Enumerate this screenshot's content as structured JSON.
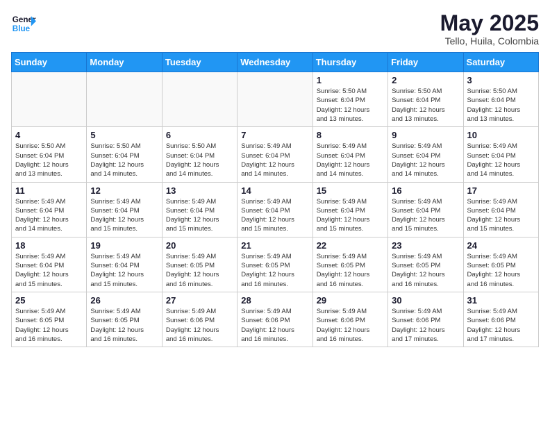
{
  "header": {
    "logo_line1": "General",
    "logo_line2": "Blue",
    "month": "May 2025",
    "location": "Tello, Huila, Colombia"
  },
  "days_of_week": [
    "Sunday",
    "Monday",
    "Tuesday",
    "Wednesday",
    "Thursday",
    "Friday",
    "Saturday"
  ],
  "weeks": [
    [
      {
        "day": "",
        "info": ""
      },
      {
        "day": "",
        "info": ""
      },
      {
        "day": "",
        "info": ""
      },
      {
        "day": "",
        "info": ""
      },
      {
        "day": "1",
        "info": "Sunrise: 5:50 AM\nSunset: 6:04 PM\nDaylight: 12 hours\nand 13 minutes."
      },
      {
        "day": "2",
        "info": "Sunrise: 5:50 AM\nSunset: 6:04 PM\nDaylight: 12 hours\nand 13 minutes."
      },
      {
        "day": "3",
        "info": "Sunrise: 5:50 AM\nSunset: 6:04 PM\nDaylight: 12 hours\nand 13 minutes."
      }
    ],
    [
      {
        "day": "4",
        "info": "Sunrise: 5:50 AM\nSunset: 6:04 PM\nDaylight: 12 hours\nand 13 minutes."
      },
      {
        "day": "5",
        "info": "Sunrise: 5:50 AM\nSunset: 6:04 PM\nDaylight: 12 hours\nand 14 minutes."
      },
      {
        "day": "6",
        "info": "Sunrise: 5:50 AM\nSunset: 6:04 PM\nDaylight: 12 hours\nand 14 minutes."
      },
      {
        "day": "7",
        "info": "Sunrise: 5:49 AM\nSunset: 6:04 PM\nDaylight: 12 hours\nand 14 minutes."
      },
      {
        "day": "8",
        "info": "Sunrise: 5:49 AM\nSunset: 6:04 PM\nDaylight: 12 hours\nand 14 minutes."
      },
      {
        "day": "9",
        "info": "Sunrise: 5:49 AM\nSunset: 6:04 PM\nDaylight: 12 hours\nand 14 minutes."
      },
      {
        "day": "10",
        "info": "Sunrise: 5:49 AM\nSunset: 6:04 PM\nDaylight: 12 hours\nand 14 minutes."
      }
    ],
    [
      {
        "day": "11",
        "info": "Sunrise: 5:49 AM\nSunset: 6:04 PM\nDaylight: 12 hours\nand 14 minutes."
      },
      {
        "day": "12",
        "info": "Sunrise: 5:49 AM\nSunset: 6:04 PM\nDaylight: 12 hours\nand 15 minutes."
      },
      {
        "day": "13",
        "info": "Sunrise: 5:49 AM\nSunset: 6:04 PM\nDaylight: 12 hours\nand 15 minutes."
      },
      {
        "day": "14",
        "info": "Sunrise: 5:49 AM\nSunset: 6:04 PM\nDaylight: 12 hours\nand 15 minutes."
      },
      {
        "day": "15",
        "info": "Sunrise: 5:49 AM\nSunset: 6:04 PM\nDaylight: 12 hours\nand 15 minutes."
      },
      {
        "day": "16",
        "info": "Sunrise: 5:49 AM\nSunset: 6:04 PM\nDaylight: 12 hours\nand 15 minutes."
      },
      {
        "day": "17",
        "info": "Sunrise: 5:49 AM\nSunset: 6:04 PM\nDaylight: 12 hours\nand 15 minutes."
      }
    ],
    [
      {
        "day": "18",
        "info": "Sunrise: 5:49 AM\nSunset: 6:04 PM\nDaylight: 12 hours\nand 15 minutes."
      },
      {
        "day": "19",
        "info": "Sunrise: 5:49 AM\nSunset: 6:04 PM\nDaylight: 12 hours\nand 15 minutes."
      },
      {
        "day": "20",
        "info": "Sunrise: 5:49 AM\nSunset: 6:05 PM\nDaylight: 12 hours\nand 16 minutes."
      },
      {
        "day": "21",
        "info": "Sunrise: 5:49 AM\nSunset: 6:05 PM\nDaylight: 12 hours\nand 16 minutes."
      },
      {
        "day": "22",
        "info": "Sunrise: 5:49 AM\nSunset: 6:05 PM\nDaylight: 12 hours\nand 16 minutes."
      },
      {
        "day": "23",
        "info": "Sunrise: 5:49 AM\nSunset: 6:05 PM\nDaylight: 12 hours\nand 16 minutes."
      },
      {
        "day": "24",
        "info": "Sunrise: 5:49 AM\nSunset: 6:05 PM\nDaylight: 12 hours\nand 16 minutes."
      }
    ],
    [
      {
        "day": "25",
        "info": "Sunrise: 5:49 AM\nSunset: 6:05 PM\nDaylight: 12 hours\nand 16 minutes."
      },
      {
        "day": "26",
        "info": "Sunrise: 5:49 AM\nSunset: 6:05 PM\nDaylight: 12 hours\nand 16 minutes."
      },
      {
        "day": "27",
        "info": "Sunrise: 5:49 AM\nSunset: 6:06 PM\nDaylight: 12 hours\nand 16 minutes."
      },
      {
        "day": "28",
        "info": "Sunrise: 5:49 AM\nSunset: 6:06 PM\nDaylight: 12 hours\nand 16 minutes."
      },
      {
        "day": "29",
        "info": "Sunrise: 5:49 AM\nSunset: 6:06 PM\nDaylight: 12 hours\nand 16 minutes."
      },
      {
        "day": "30",
        "info": "Sunrise: 5:49 AM\nSunset: 6:06 PM\nDaylight: 12 hours\nand 17 minutes."
      },
      {
        "day": "31",
        "info": "Sunrise: 5:49 AM\nSunset: 6:06 PM\nDaylight: 12 hours\nand 17 minutes."
      }
    ]
  ]
}
